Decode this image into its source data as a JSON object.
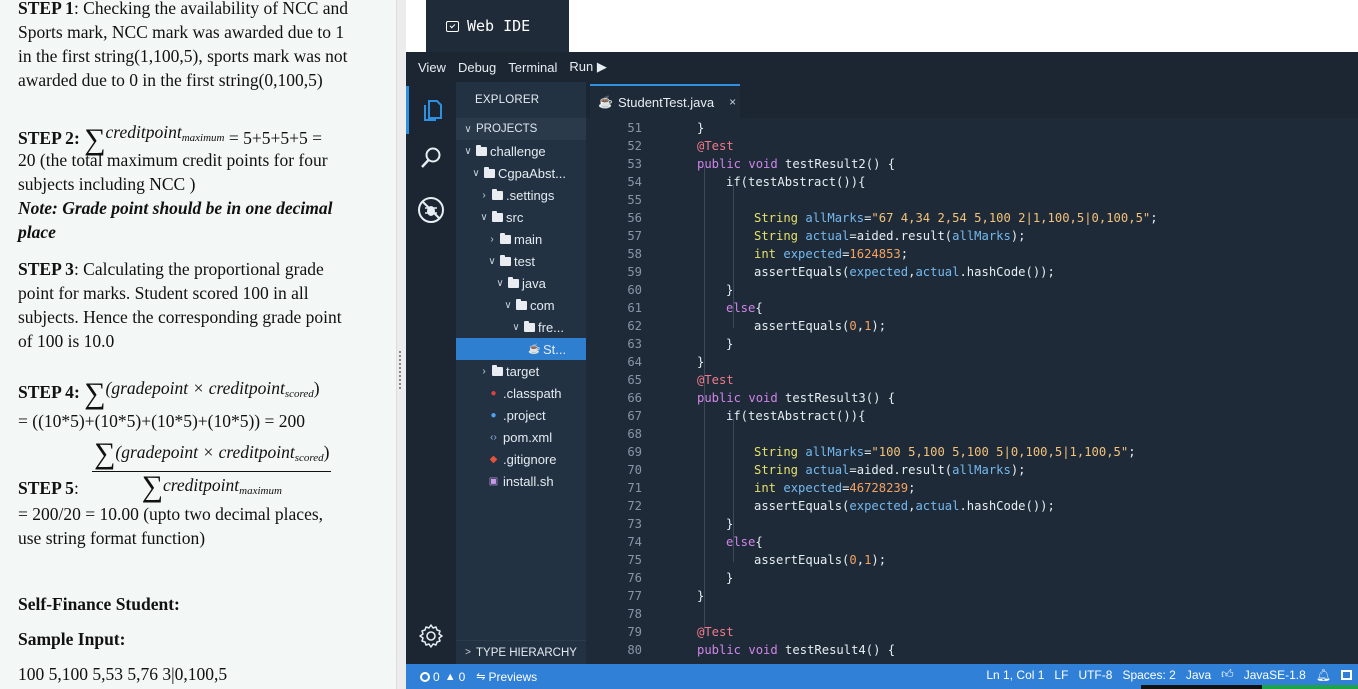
{
  "instructions": {
    "step1": {
      "label": "STEP 1",
      "line1": ": Checking the availability of NCC and",
      "line2": "Sports mark, NCC mark was awarded due to 1",
      "line3": "in the first string(1,100,5), sports mark was not",
      "line4": "awarded due to 0 in the first string(0,100,5)"
    },
    "step2": {
      "label": "STEP 2",
      "formula_var": "creditpoint",
      "formula_sub": "maximum",
      "formula_rhs": "= 5+5+5+5 =",
      "line2": "20 (the total maximum credit points for four",
      "line3": "subjects including NCC )",
      "note1": "Note: Grade point should be in one decimal",
      "note2": "place"
    },
    "step3": {
      "label": "STEP 3",
      "line1": ": Calculating the proportional grade",
      "line2": "point for marks. Student scored 100 in all",
      "line3": "subjects. Hence the corresponding grade point",
      "line4": "of 100 is 10.0"
    },
    "step4": {
      "label": "STEP 4",
      "formula_open": "(gradepoint × creditpoint",
      "formula_sub": "scored",
      "formula_close": ")",
      "line2": "= ((10*5)+(10*5)+(10*5)+(10*5)) = 200"
    },
    "step5": {
      "label": "STEP 5",
      "colon": ":",
      "num_open": "(gradepoint × creditpoint",
      "num_sub": "scored",
      "num_close": ")",
      "den_var": "creditpoint",
      "den_sub": "maximum",
      "line2": "= 200/20 = 10.00 (upto two decimal places,",
      "line3": "use string format function)"
    },
    "self_finance_title": "Self-Finance  Student:",
    "sample_input_title": "Sample Input:",
    "sample_input_value": "100 5,100 5,53 5,76 3|0,100,5"
  },
  "ide": {
    "title": "Web IDE",
    "menu": [
      "View",
      "Debug",
      "Terminal",
      "Run ▶"
    ],
    "explorer_title": "EXPLORER",
    "projects_title": "PROJECTS",
    "tree": [
      {
        "label": "challenge",
        "type": "folder",
        "chev": "v"
      },
      {
        "label": "CgpaAbst...",
        "type": "folder",
        "chev": "v"
      },
      {
        "label": ".settings",
        "type": "folder",
        "chev": ">"
      },
      {
        "label": "src",
        "type": "folder",
        "chev": "v"
      },
      {
        "label": "main",
        "type": "folder",
        "chev": ">"
      },
      {
        "label": "test",
        "type": "folder",
        "chev": "v"
      },
      {
        "label": "java",
        "type": "folder",
        "chev": "v"
      },
      {
        "label": "com",
        "type": "folder",
        "chev": "v"
      },
      {
        "label": "fre...",
        "type": "folder",
        "chev": "v"
      },
      {
        "label": "St...",
        "type": "java",
        "chev": ""
      },
      {
        "label": "target",
        "type": "folder",
        "chev": ">"
      },
      {
        "label": ".classpath",
        "type": "classpath",
        "chev": ""
      },
      {
        "label": ".project",
        "type": "project",
        "chev": ""
      },
      {
        "label": "pom.xml",
        "type": "xml",
        "chev": ""
      },
      {
        "label": ".gitignore",
        "type": "git",
        "chev": ""
      },
      {
        "label": "install.sh",
        "type": "sh",
        "chev": ""
      }
    ],
    "type_hierarchy": "TYPE HIERARCHY",
    "tab_label": "StudentTest.java",
    "tab_close": "×",
    "line_numbers": [
      "51",
      "52",
      "53",
      "54",
      "55",
      "56",
      "57",
      "58",
      "59",
      "60",
      "61",
      "62",
      "63",
      "64",
      "65",
      "66",
      "67",
      "68",
      "69",
      "70",
      "71",
      "72",
      "73",
      "74",
      "75",
      "76",
      "77",
      "78",
      "79",
      "80"
    ],
    "code": {
      "l51": "}",
      "l52_ann": "@Test",
      "l53_kw": "public void",
      "l53_fn": " testResult2() {",
      "l54_fn": "if(testAbstract()){",
      "l56_ty": "String",
      "l56_vr": "allMarks",
      "l56_st": "\"67 4,34 2,54 5,100 2|1,100,5|0,100,5\"",
      "l57_ty": "String",
      "l57_vr": "actual",
      "l57_fn": "aided.result(",
      "l57_vr2": "allMarks",
      "l57_end": ");",
      "l58_ty": "int",
      "l58_vr": "expected",
      "l58_nu": "1624853",
      "l59_fn": "assertEquals(",
      "l59_vr": "expected",
      "l59_vr2": "actual",
      "l59_end": ".hashCode());",
      "l60": "}",
      "l61_kw": "else",
      "l61_b": "{",
      "l62_fn": "assertEquals(",
      "l62_nu1": "0",
      "l62_nu2": "1",
      "l62_end": ");",
      "l63": "}",
      "l64": "}",
      "l65_ann": "@Test",
      "l66_kw": "public void",
      "l66_fn": " testResult3() {",
      "l67_fn": "if(testAbstract()){",
      "l69_ty": "String",
      "l69_vr": "allMarks",
      "l69_st": "\"100 5,100 5,100 5|0,100,5|1,100,5\"",
      "l70_ty": "String",
      "l70_vr": "actual",
      "l70_fn": "aided.result(",
      "l70_vr2": "allMarks",
      "l70_end": ");",
      "l71_ty": "int",
      "l71_vr": "expected",
      "l71_nu": "46728239",
      "l72_fn": "assertEquals(",
      "l72_vr": "expected",
      "l72_vr2": "actual",
      "l72_end": ".hashCode());",
      "l73": "}",
      "l74_kw": "else",
      "l74_b": "{",
      "l75_fn": "assertEquals(",
      "l75_nu1": "0",
      "l75_nu2": "1",
      "l75_end": ");",
      "l76": "}",
      "l77": "}",
      "l79_ann": "@Test",
      "l80_kw": "public void",
      "l80_fn": " testResult4() {"
    },
    "status": {
      "errors": "0",
      "warnings": "0",
      "previews": "Previews",
      "position": "Ln 1, Col 1",
      "eol": "LF",
      "encoding": "UTF-8",
      "spaces": "Spaces: 2",
      "language": "Java",
      "jdk": "JavaSE-1.8"
    },
    "colors": {
      "accent": "#2f80d6",
      "sidebar_bg": "#233242",
      "editor_bg": "#1e2a37"
    }
  }
}
